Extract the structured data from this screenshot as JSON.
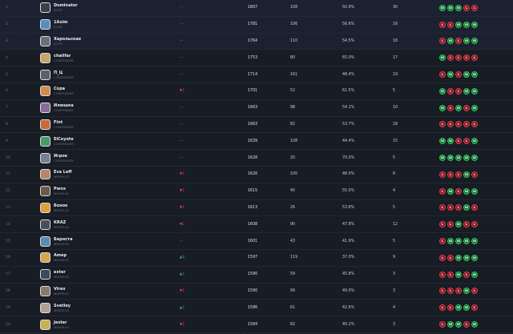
{
  "colors": {
    "background": "#151a22",
    "win": "#1b7a3a",
    "loss": "#8a1e2a",
    "up": "#2fb15a",
    "down": "#e0414b"
  },
  "rows": [
    {
      "rank": "1",
      "name": "Dominator",
      "tier": "ELITE",
      "change": "—",
      "dir": "none",
      "elo": "1807",
      "games": "108",
      "winrate": "50.9%",
      "adr": "30",
      "form": [
        "W",
        "W",
        "W",
        "L",
        "L"
      ]
    },
    {
      "rank": "2",
      "name": "1Axim",
      "tier": "ELITE",
      "change": "—",
      "dir": "none",
      "elo": "1781",
      "games": "106",
      "winrate": "56.6%",
      "adr": "16",
      "form": [
        "L",
        "L",
        "W",
        "W",
        "W"
      ]
    },
    {
      "rank": "3",
      "name": "Харольская",
      "tier": "ELITE",
      "change": "—",
      "dir": "none",
      "elo": "1764",
      "games": "110",
      "winrate": "54.5%",
      "adr": "16",
      "form": [
        "L",
        "W",
        "L",
        "W",
        "W"
      ]
    },
    {
      "rank": "4",
      "name": "chalifar",
      "tier": "CONTENDER",
      "change": "—",
      "dir": "none",
      "elo": "1753",
      "games": "80",
      "winrate": "65.0%",
      "adr": "17",
      "form": [
        "W",
        "L",
        "L",
        "L",
        "L"
      ]
    },
    {
      "rank": "5",
      "name": "П_Ц",
      "tier": "CONTENDER",
      "change": "—",
      "dir": "none",
      "elo": "1714",
      "games": "161",
      "winrate": "48.4%",
      "adr": "19",
      "form": [
        "L",
        "W",
        "L",
        "W",
        "W"
      ]
    },
    {
      "rank": "6",
      "name": "Сора",
      "tier": "CONTENDER",
      "change": "▼1",
      "dir": "down",
      "elo": "1701",
      "games": "52",
      "winrate": "61.5%",
      "adr": "5",
      "form": [
        "W",
        "L",
        "L",
        "W",
        "W"
      ]
    },
    {
      "rank": "7",
      "name": "Илюшка",
      "tier": "CONTENDER",
      "change": "—",
      "dir": "none",
      "elo": "1663",
      "games": "98",
      "winrate": "54.1%",
      "adr": "10",
      "form": [
        "W",
        "L",
        "W",
        "L",
        "W"
      ]
    },
    {
      "rank": "8",
      "name": "Fint",
      "tier": "CONTENDER",
      "change": "—",
      "dir": "none",
      "elo": "1663",
      "games": "82",
      "winrate": "53.7%",
      "adr": "18",
      "form": [
        "L",
        "L",
        "L",
        "L",
        "L"
      ]
    },
    {
      "rank": "9",
      "name": "ElCoyote",
      "tier": "CONTENDER",
      "change": "—",
      "dir": "none",
      "elo": "1639",
      "games": "108",
      "winrate": "44.4%",
      "adr": "15",
      "form": [
        "W",
        "W",
        "L",
        "L",
        "W"
      ]
    },
    {
      "rank": "10",
      "name": "Игрок",
      "tier": "CONTENDER",
      "change": "—",
      "dir": "none",
      "elo": "1628",
      "games": "20",
      "winrate": "70.0%",
      "adr": "5",
      "form": [
        "W",
        "W",
        "W",
        "W",
        "W"
      ]
    },
    {
      "rank": "11",
      "name": "Eva Leff",
      "tier": "MIDFIELD",
      "change": "▼1",
      "dir": "down",
      "elo": "1626",
      "games": "100",
      "winrate": "48.0%",
      "adr": "8",
      "form": [
        "L",
        "L",
        "L",
        "W",
        "L"
      ]
    },
    {
      "rank": "12",
      "name": "Pwnx",
      "tier": "MIDFIELD",
      "change": "▼1",
      "dir": "down",
      "elo": "1615",
      "games": "40",
      "winrate": "55.0%",
      "adr": "4",
      "form": [
        "L",
        "W",
        "L",
        "W",
        "W"
      ]
    },
    {
      "rank": "13",
      "name": "Бонок",
      "tier": "MIDFIELD",
      "change": "▼1",
      "dir": "down",
      "elo": "1613",
      "games": "26",
      "winrate": "53.8%",
      "adr": "5",
      "form": [
        "L",
        "L",
        "L",
        "W",
        "L"
      ]
    },
    {
      "rank": "14",
      "name": "KRAZ",
      "tier": "MIDFIELD",
      "change": "▼1",
      "dir": "down",
      "elo": "1608",
      "games": "90",
      "winrate": "47.8%",
      "adr": "12",
      "form": [
        "L",
        "L",
        "W",
        "L",
        "L"
      ]
    },
    {
      "rank": "15",
      "name": "Барнста",
      "tier": "MIDFIELD",
      "change": "—",
      "dir": "none",
      "elo": "1601",
      "games": "43",
      "winrate": "41.9%",
      "adr": "5",
      "form": [
        "L",
        "W",
        "W",
        "W",
        "W"
      ]
    },
    {
      "rank": "16",
      "name": "Amep",
      "tier": "MIDFIELD",
      "change": "▲4",
      "dir": "up",
      "elo": "1597",
      "games": "119",
      "winrate": "37.0%",
      "adr": "9",
      "form": [
        "L",
        "L",
        "W",
        "W",
        "W"
      ]
    },
    {
      "rank": "17",
      "name": "exter",
      "tier": "MIDFIELD",
      "change": "▲1",
      "dir": "up",
      "elo": "1590",
      "games": "59",
      "winrate": "45.8%",
      "adr": "3",
      "form": [
        "L",
        "L",
        "W",
        "L",
        "W"
      ]
    },
    {
      "rank": "18",
      "name": "Virex",
      "tier": "MIDFIELD",
      "change": "▼1",
      "dir": "down",
      "elo": "1590",
      "games": "99",
      "winrate": "49.0%",
      "adr": "3",
      "form": [
        "L",
        "L",
        "L",
        "W",
        "L"
      ]
    },
    {
      "rank": "19",
      "name": "Svetley",
      "tier": "MIDFIELD",
      "change": "▲1",
      "dir": "up",
      "elo": "1586",
      "games": "61",
      "winrate": "42.6%",
      "adr": "4",
      "form": [
        "L",
        "L",
        "W",
        "W",
        "L"
      ]
    },
    {
      "rank": "20",
      "name": "Jester",
      "tier": "MIDFIELD",
      "change": "▼2",
      "dir": "down",
      "elo": "1584",
      "games": "82",
      "winrate": "40.2%",
      "adr": "3",
      "form": [
        "L",
        "W",
        "W",
        "L",
        "W"
      ]
    }
  ]
}
